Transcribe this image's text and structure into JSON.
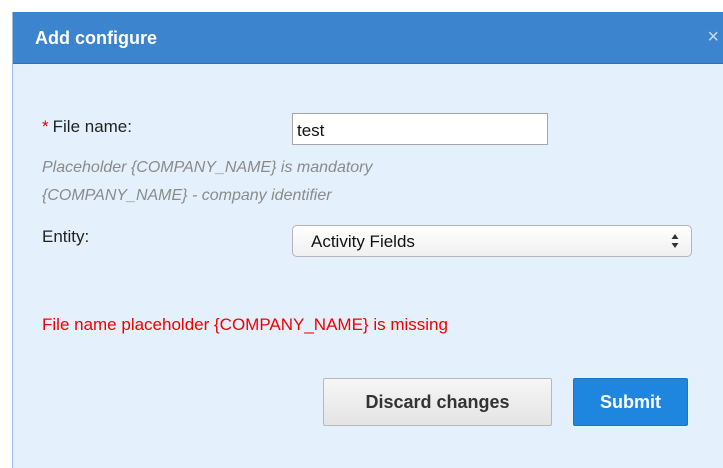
{
  "dialog": {
    "title": "Add configure",
    "close_glyph": "×",
    "close_icon": "close-icon"
  },
  "form": {
    "required_marker": "*",
    "file_name_label": "File name:",
    "file_name_value": "test",
    "hint_line_1": "Placeholder {COMPANY_NAME} is mandatory",
    "hint_line_2": "{COMPANY_NAME} - company identifier",
    "entity_label": "Entity:",
    "entity_selected": "Activity Fields",
    "entity_arrows_icon": "up-down-arrows-icon"
  },
  "error_message": "File name placeholder {COMPANY_NAME} is missing",
  "buttons": {
    "discard_label": "Discard changes",
    "submit_label": "Submit"
  },
  "colors": {
    "titlebar": "#3d84cf",
    "dialog_bg": "#e4f0fb",
    "error": "#f20000",
    "required": "#e10000",
    "submit": "#1f86e0"
  }
}
